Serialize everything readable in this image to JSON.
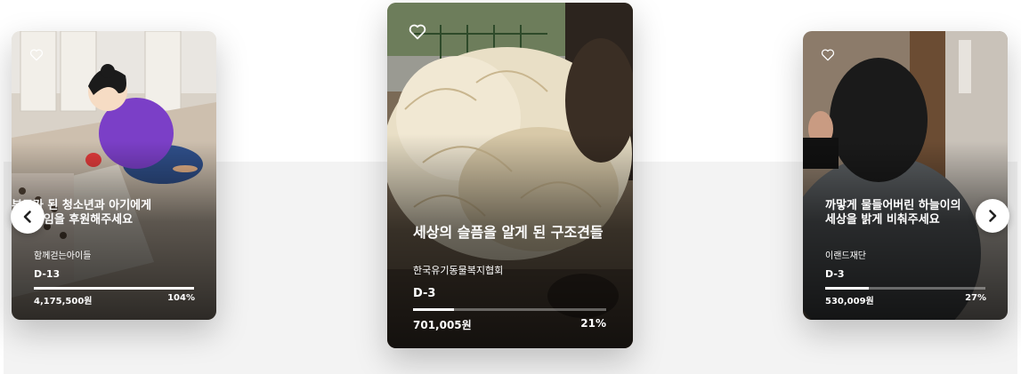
{
  "cards": [
    {
      "title_line1": "부모가 된 청소년과 아기에게",
      "title_line2": "든든타임을 후원해주세요",
      "org": "함께걷는아이들",
      "dday": "D-13",
      "amount": "4,175,500원",
      "percent_label": "104%",
      "progress": 1.0
    },
    {
      "title_line1": "세상의 슬픔을 알게 된 구조견들",
      "title_line2": "",
      "org": "한국유기동물복지협회",
      "dday": "D-3",
      "amount": "701,005원",
      "percent_label": "21%",
      "progress": 0.21
    },
    {
      "title_line1": "까맣게 물들어버린 하늘이의",
      "title_line2": "세상을 밝게 비춰주세요",
      "org": "이랜드재단",
      "dday": "D-3",
      "amount": "530,009원",
      "percent_label": "27%",
      "progress": 0.27
    }
  ],
  "icons": {
    "heart": "heart-outline-icon",
    "prev": "chevron-left-icon",
    "next": "chevron-right-icon"
  }
}
